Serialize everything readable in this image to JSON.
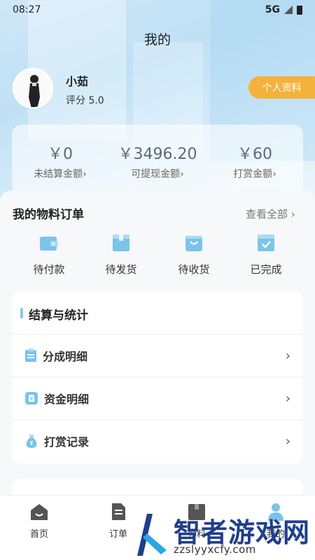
{
  "status_bar": {
    "time": "08:27",
    "network": "5G"
  },
  "header": {
    "title": "我的"
  },
  "user": {
    "name": "小茹",
    "rating": "评分 5.0",
    "profile_button": "个人资料"
  },
  "stats": [
    {
      "value": "￥0",
      "label": "未结算金额",
      "chevron": "›"
    },
    {
      "value": "￥3496.20",
      "label": "可提现金额",
      "chevron": "›"
    },
    {
      "value": "￥60",
      "label": "打赏金额",
      "chevron": "›"
    }
  ],
  "orders": {
    "title": "我的物料订单",
    "view_all": "查看全部 ›",
    "items": [
      {
        "label": "待付款",
        "icon": "wallet-icon"
      },
      {
        "label": "待发货",
        "icon": "box-icon"
      },
      {
        "label": "待收货",
        "icon": "bag-icon"
      },
      {
        "label": "已完成",
        "icon": "check-box-icon"
      }
    ]
  },
  "settlement": {
    "title": "结算与统计",
    "rows": [
      {
        "label": "分成明细",
        "icon": "clipboard-icon",
        "chevron": "›"
      },
      {
        "label": "资金明细",
        "icon": "money-card-icon",
        "chevron": "›"
      },
      {
        "label": "打赏记录",
        "icon": "money-bag-icon",
        "chevron": "›"
      }
    ]
  },
  "tabbar": {
    "items": [
      {
        "label": "首页",
        "icon": "home-icon"
      },
      {
        "label": "订单",
        "icon": "document-icon"
      },
      {
        "label": "物料",
        "icon": "box-icon"
      },
      {
        "label": "我的",
        "icon": "person-icon"
      }
    ]
  },
  "watermark": {
    "text": "智者游戏网",
    "url": "zzslyyxcfy.com"
  },
  "colors": {
    "accent": "#f5b23b",
    "icon_blue": "#7cc3ea",
    "brand_dark": "#1f3f8c"
  }
}
